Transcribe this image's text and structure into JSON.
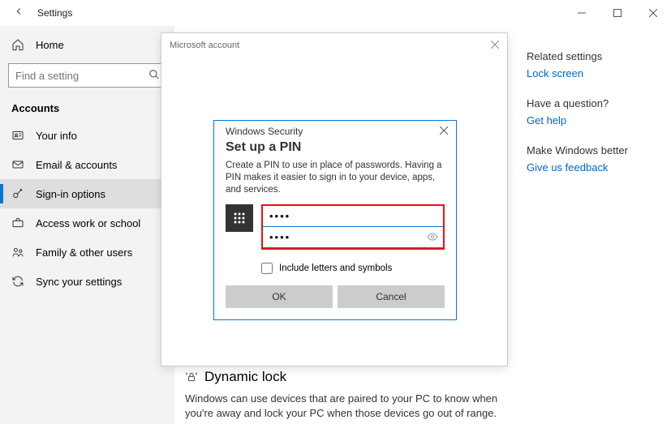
{
  "titlebar": {
    "app_name": "Settings"
  },
  "sidebar": {
    "home": "Home",
    "search_placeholder": "Find a setting",
    "section": "Accounts",
    "items": [
      {
        "label": "Your info"
      },
      {
        "label": "Email & accounts"
      },
      {
        "label": "Sign-in options"
      },
      {
        "label": "Access work or school"
      },
      {
        "label": "Family & other users"
      },
      {
        "label": "Sync your settings"
      }
    ]
  },
  "right": {
    "related_heading": "Related settings",
    "related_link": "Lock screen",
    "question_heading": "Have a question?",
    "question_link": "Get help",
    "better_heading": "Make Windows better",
    "better_link": "Give us feedback"
  },
  "dynamic_lock": {
    "title": "Dynamic lock",
    "text": "Windows can use devices that are paired to your PC to know when you're away and lock your PC when those devices go out of range."
  },
  "ms_modal": {
    "title": "Microsoft account"
  },
  "sec": {
    "header": "Windows Security",
    "title": "Set up a PIN",
    "desc": "Create a PIN to use in place of passwords. Having a PIN makes it easier to sign in to your device, apps, and services.",
    "pin1": "••••",
    "pin2": "••••",
    "checkbox_label": "Include letters and symbols",
    "ok": "OK",
    "cancel": "Cancel"
  }
}
